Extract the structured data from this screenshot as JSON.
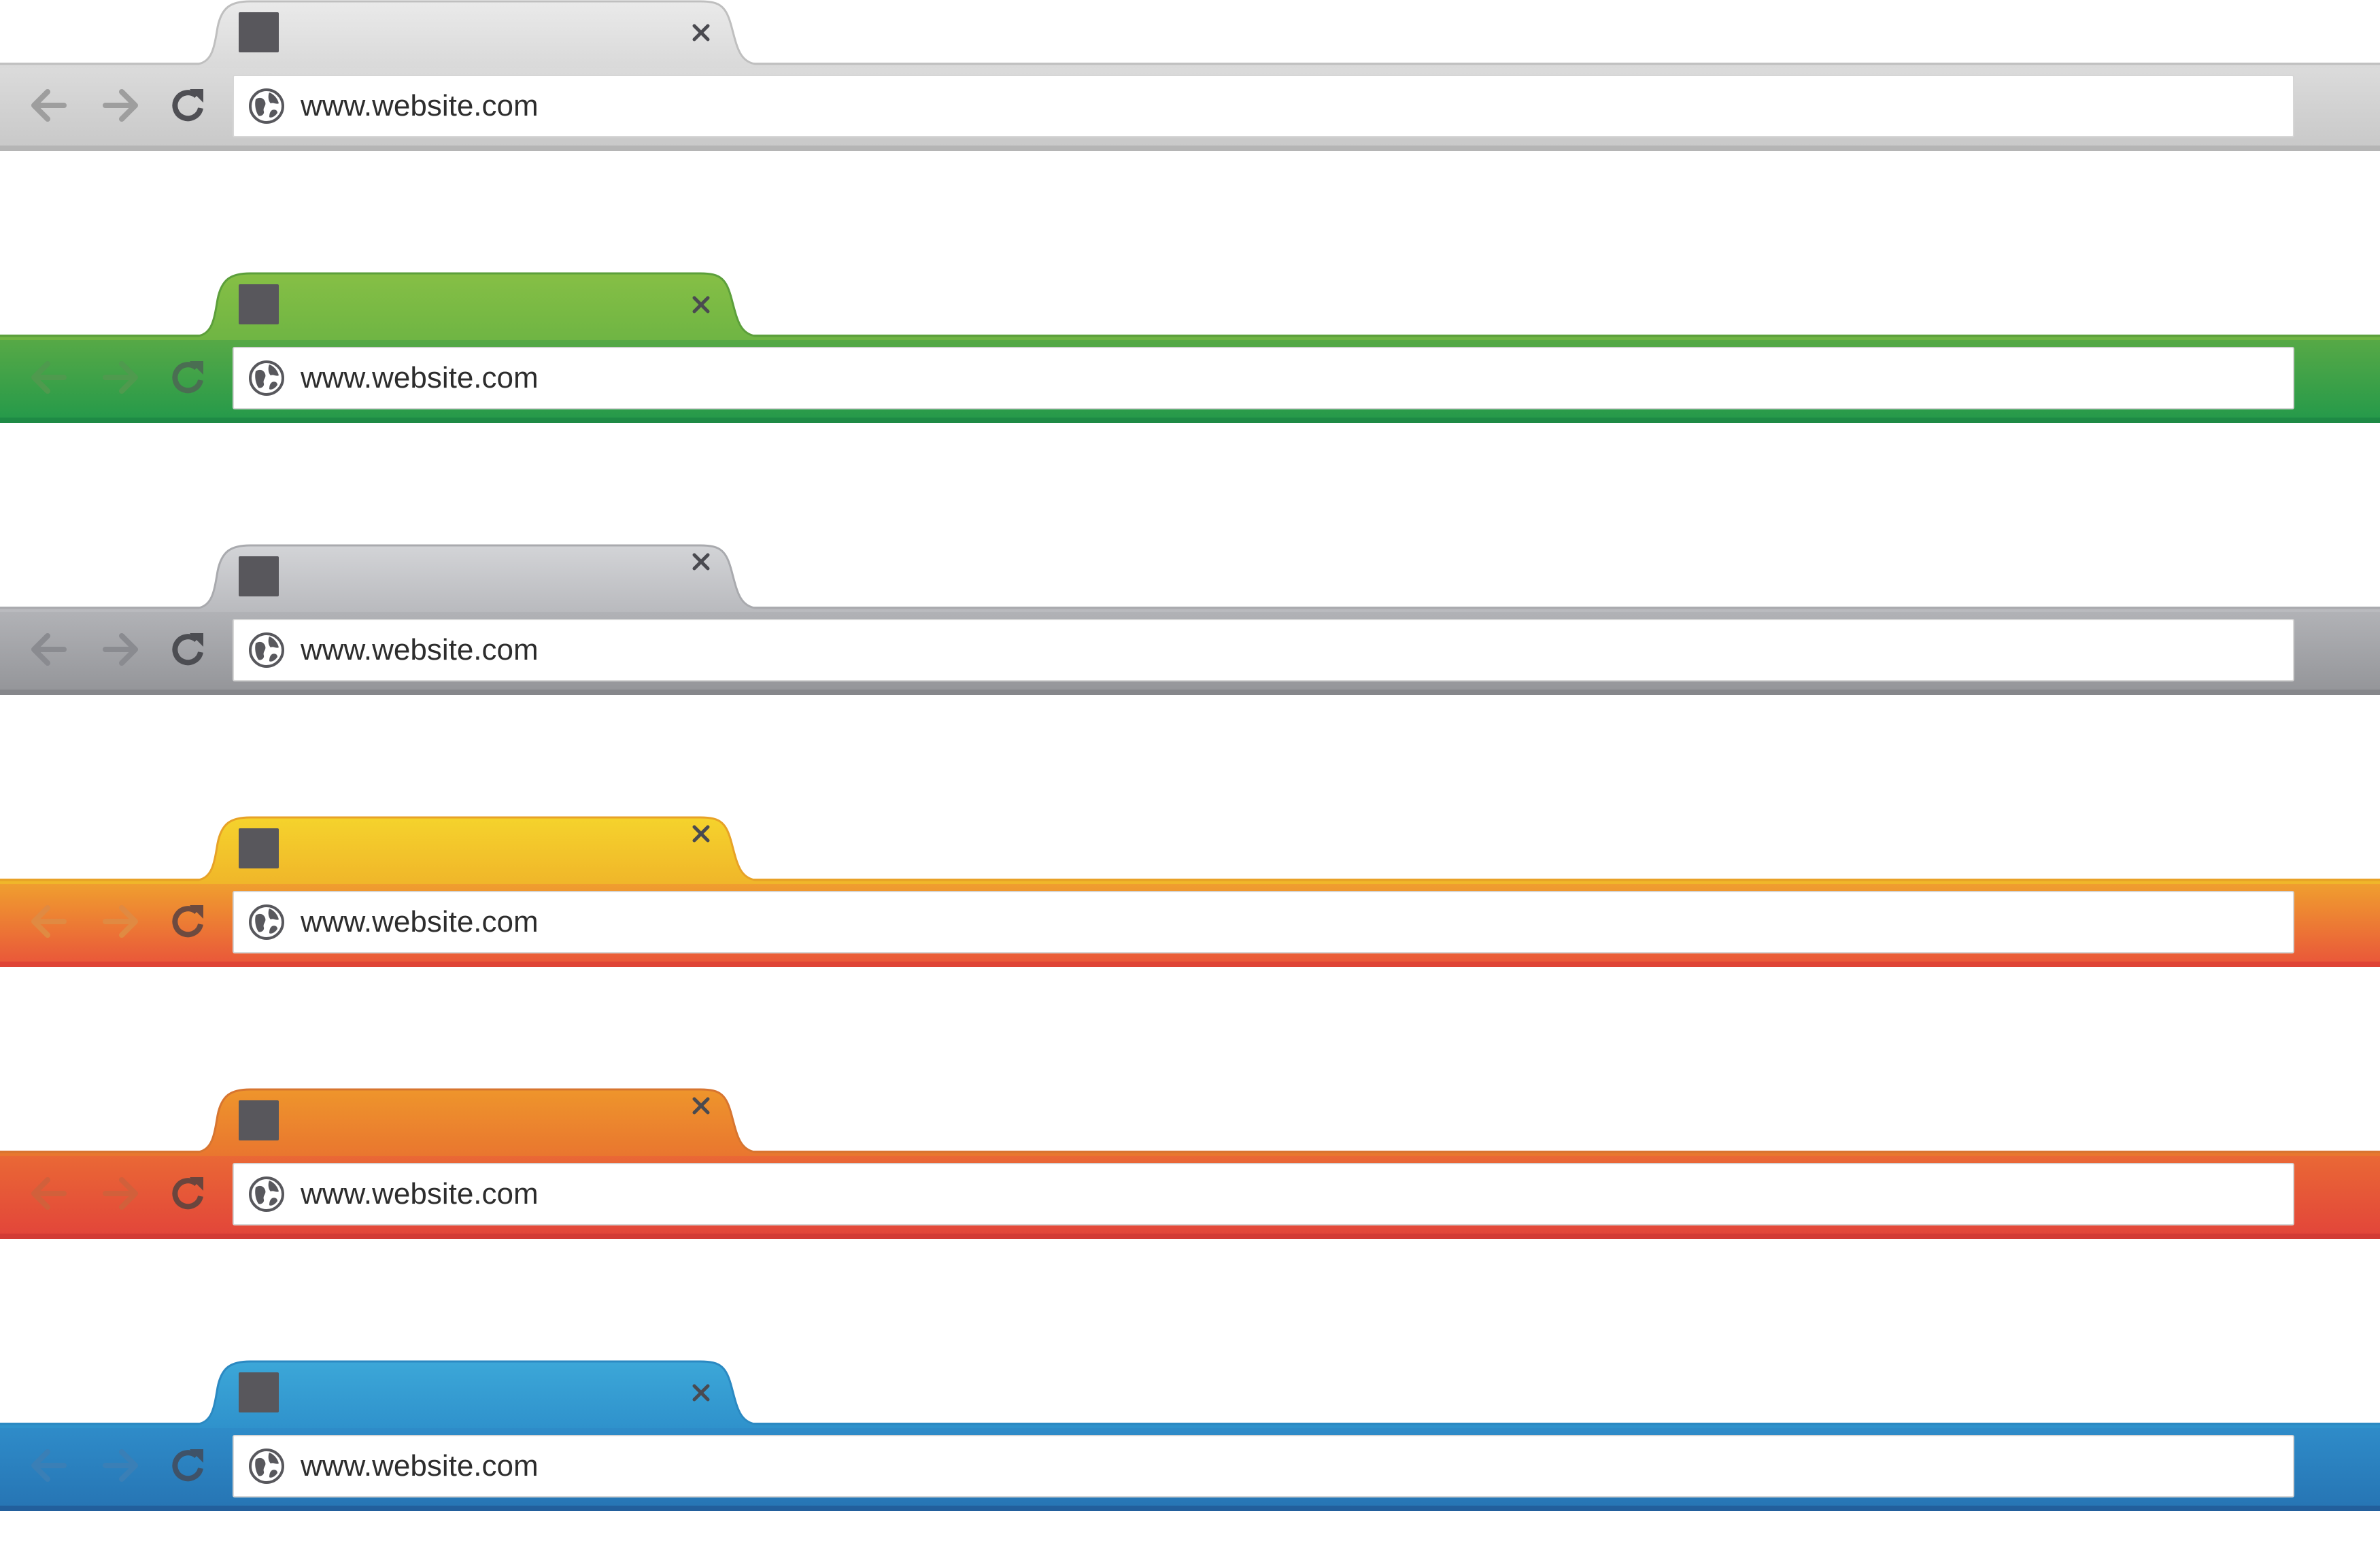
{
  "bars": [
    {
      "theme": "light-gray",
      "url": "www.website.com",
      "colors": {
        "tab_top": "#eaeaea",
        "tab_bottom": "#d9d9d9",
        "bar_top": "#dcdcdc",
        "bar_bottom": "#c8c8c8",
        "edge": "#bfbfbf",
        "bottom_line": "#b5b5b5",
        "icon": "#8f8f8f",
        "icon_dim": "#9e9e9e",
        "reload": "#4f4f54"
      }
    },
    {
      "theme": "green",
      "url": "www.website.com",
      "colors": {
        "tab_top": "#86bf45",
        "tab_bottom": "#6fb544",
        "bar_top": "#5aaa46",
        "bar_bottom": "#23994a",
        "edge": "#5c9f3b",
        "bottom_line": "#1e8a45",
        "icon": "#4d8a46",
        "icon_dim": "#4f9a4e",
        "reload": "#4a6e52"
      }
    },
    {
      "theme": "dark-gray",
      "url": "www.website.com",
      "colors": {
        "tab_top": "#d3d4d7",
        "tab_bottom": "#b9babe",
        "bar_top": "#b3b4b8",
        "bar_bottom": "#939498",
        "edge": "#a9aaae",
        "bottom_line": "#86878b",
        "icon": "#7d7e83",
        "icon_dim": "#8a8b90",
        "reload": "#4c4d52"
      }
    },
    {
      "theme": "yellow-orange",
      "url": "www.website.com",
      "colors": {
        "tab_top": "#f5d32c",
        "tab_bottom": "#f0b62a",
        "bar_top": "#f0a32e",
        "bar_bottom": "#e9543a",
        "edge": "#e7a227",
        "bottom_line": "#df4436",
        "icon": "#d9753f",
        "icon_dim": "#e08a42",
        "reload": "#6d4a3f"
      }
    },
    {
      "theme": "orange-red",
      "url": "www.website.com",
      "colors": {
        "tab_top": "#ee952c",
        "tab_bottom": "#e9762f",
        "bar_top": "#ea6a35",
        "bar_bottom": "#e2443a",
        "edge": "#d77530",
        "bottom_line": "#d23b35",
        "icon": "#c8553b",
        "icon_dim": "#d1603b",
        "reload": "#6a453d"
      }
    },
    {
      "theme": "blue",
      "url": "www.website.com",
      "colors": {
        "tab_top": "#3ca7d8",
        "tab_bottom": "#2f92cc",
        "bar_top": "#2f8dca",
        "bar_bottom": "#2674b3",
        "edge": "#2b89c2",
        "bottom_line": "#225f9c",
        "icon": "#2f6ea4",
        "icon_dim": "#3a7fb6",
        "reload": "#3f5268"
      }
    }
  ]
}
